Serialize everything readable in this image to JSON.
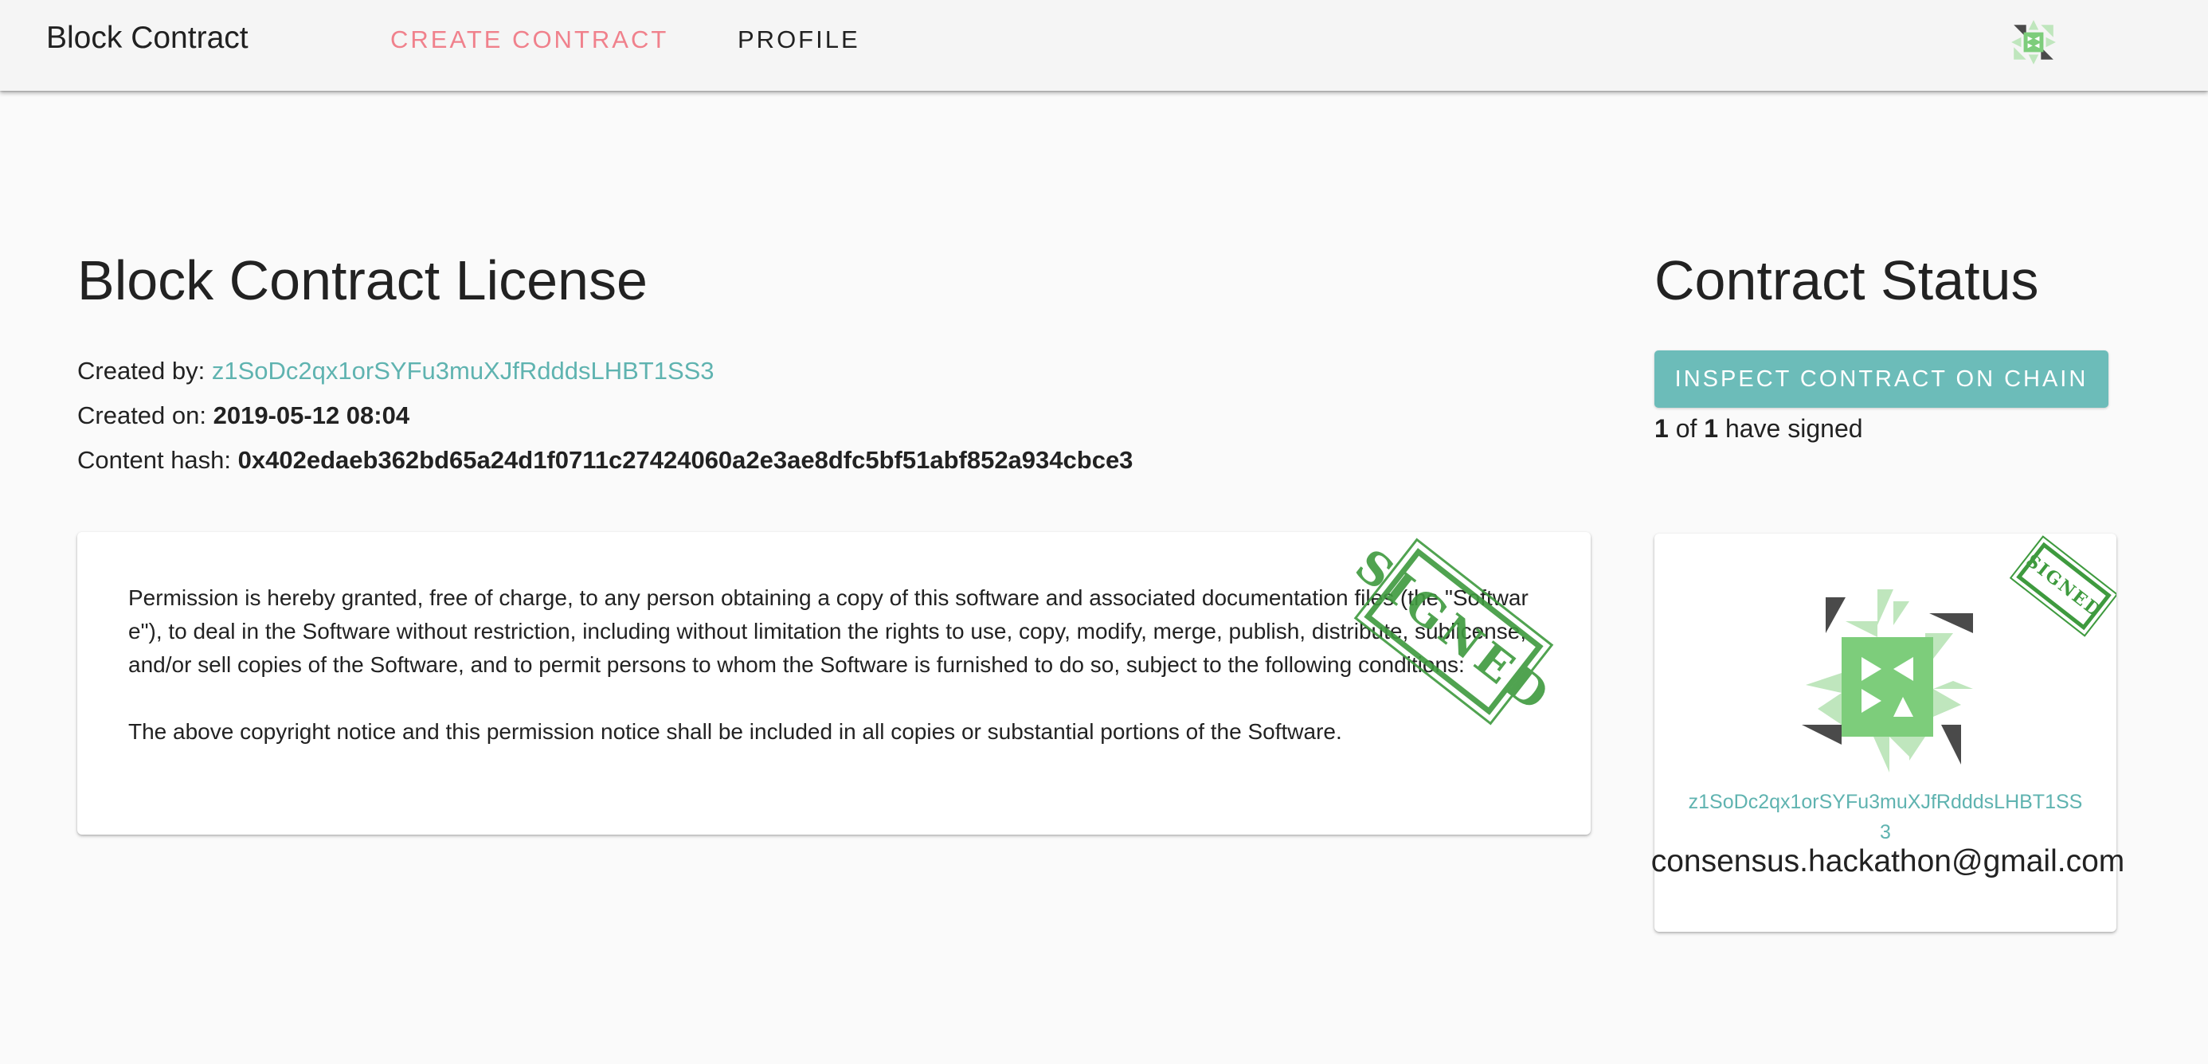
{
  "appbar": {
    "brand": "Block Contract",
    "nav": {
      "create": "CREATE CONTRACT",
      "profile": "PROFILE"
    },
    "avatar_icon": "identicon-avatar-icon"
  },
  "contract": {
    "title": "Block Contract License",
    "created_by_label": "Created by:",
    "created_by": "z1SoDc2qx1orSYFu3muXJfRdddsLHBT1SS3",
    "created_on_label": "Created on:",
    "created_on": "2019-05-12 08:04",
    "hash_label": "Content hash:",
    "hash": "0x402edaeb362bd65a24d1f0711c27424060a2e3ae8dfc5bf51abf852a934cbce3",
    "paragraphs": [
      "Permission is hereby granted, free of charge, to any person obtaining a copy of this software and associated documentation files (the \"Software\"), to deal in the Software without restriction, including without limitation the rights to use, copy, modify, merge, publish, distribute, sublicense, and/or sell copies of the Software, and to permit persons to whom the Software is furnished to do so, subject to the following conditions:",
      "The above copyright notice and this permission notice shall be included in all copies or substantial portions of the Software."
    ],
    "stamp": "SIGNED"
  },
  "status": {
    "title": "Contract Status",
    "inspect_label": "INSPECT CONTRACT ON CHAIN",
    "signed_count": "1",
    "of_label": "of",
    "total_count": "1",
    "have_signed_label": "have signed",
    "signer": {
      "address": "z1SoDc2qx1orSYFu3muXJfRdddsLHBT1SS3",
      "email": "consensus.hackathon@gmail.com",
      "stamp": "SIGNED"
    }
  },
  "colors": {
    "accent_teal": "#6cbcb9",
    "link_teal": "#5fb3b0",
    "nav_active": "#f0818c",
    "stamp_green": "#3e9a3e",
    "identicon_green": "#7dcd7b",
    "identicon_light": "#bfe6bd",
    "identicon_dark": "#4a4a4a"
  }
}
